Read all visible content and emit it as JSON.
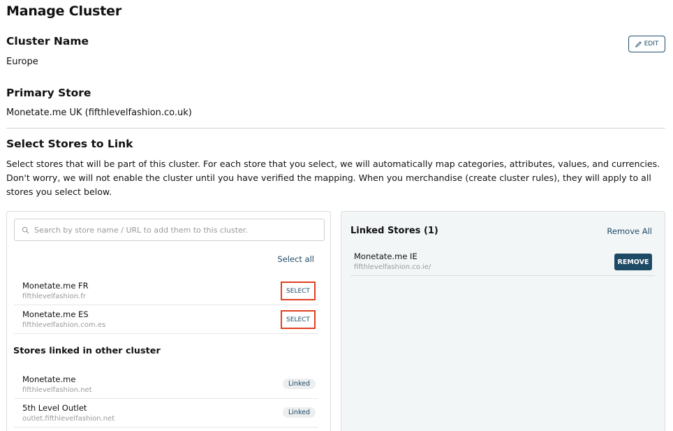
{
  "page": {
    "title": "Manage Cluster"
  },
  "cluster": {
    "name_label": "Cluster Name",
    "name_value": "Europe",
    "edit_label": "EDIT"
  },
  "primary": {
    "label": "Primary Store",
    "value": "Monetate.me UK (fifthlevelfashion.co.uk)"
  },
  "select_section": {
    "title": "Select Stores to Link",
    "description": "Select stores that will be part of this cluster. For each store that you select, we will automatically map categories, attributes, values, and currencies. Don't worry, we will not enable the cluster until you have verified the mapping. When you merchandise (create cluster rules), they will apply to all stores you select below."
  },
  "available": {
    "search_placeholder": "Search by store name / URL to add them to this cluster.",
    "select_all_label": "Select all",
    "stores": [
      {
        "name": "Monetate.me FR",
        "url": "fifthlevelfashion.fr",
        "action": "SELECT"
      },
      {
        "name": "Monetate.me ES",
        "url": "fifthlevelfashion.com.es",
        "action": "SELECT"
      }
    ],
    "other_title": "Stores linked in other cluster",
    "other_stores": [
      {
        "name": "Monetate.me",
        "url": "fifthlevelfashion.net",
        "badge": "Linked"
      },
      {
        "name": "5th Level Outlet",
        "url": "outlet.fifthlevelfashion.net",
        "badge": "Linked"
      }
    ]
  },
  "linked": {
    "title": "Linked Stores (1)",
    "remove_all_label": "Remove All",
    "stores": [
      {
        "name": "Monetate.me IE",
        "url": "fifthlevelfashion.co.ie/",
        "action": "REMOVE"
      }
    ]
  },
  "colors": {
    "accent": "#1e4a66",
    "highlight": "#e0401f",
    "panel_bg": "#f3f6f7"
  }
}
